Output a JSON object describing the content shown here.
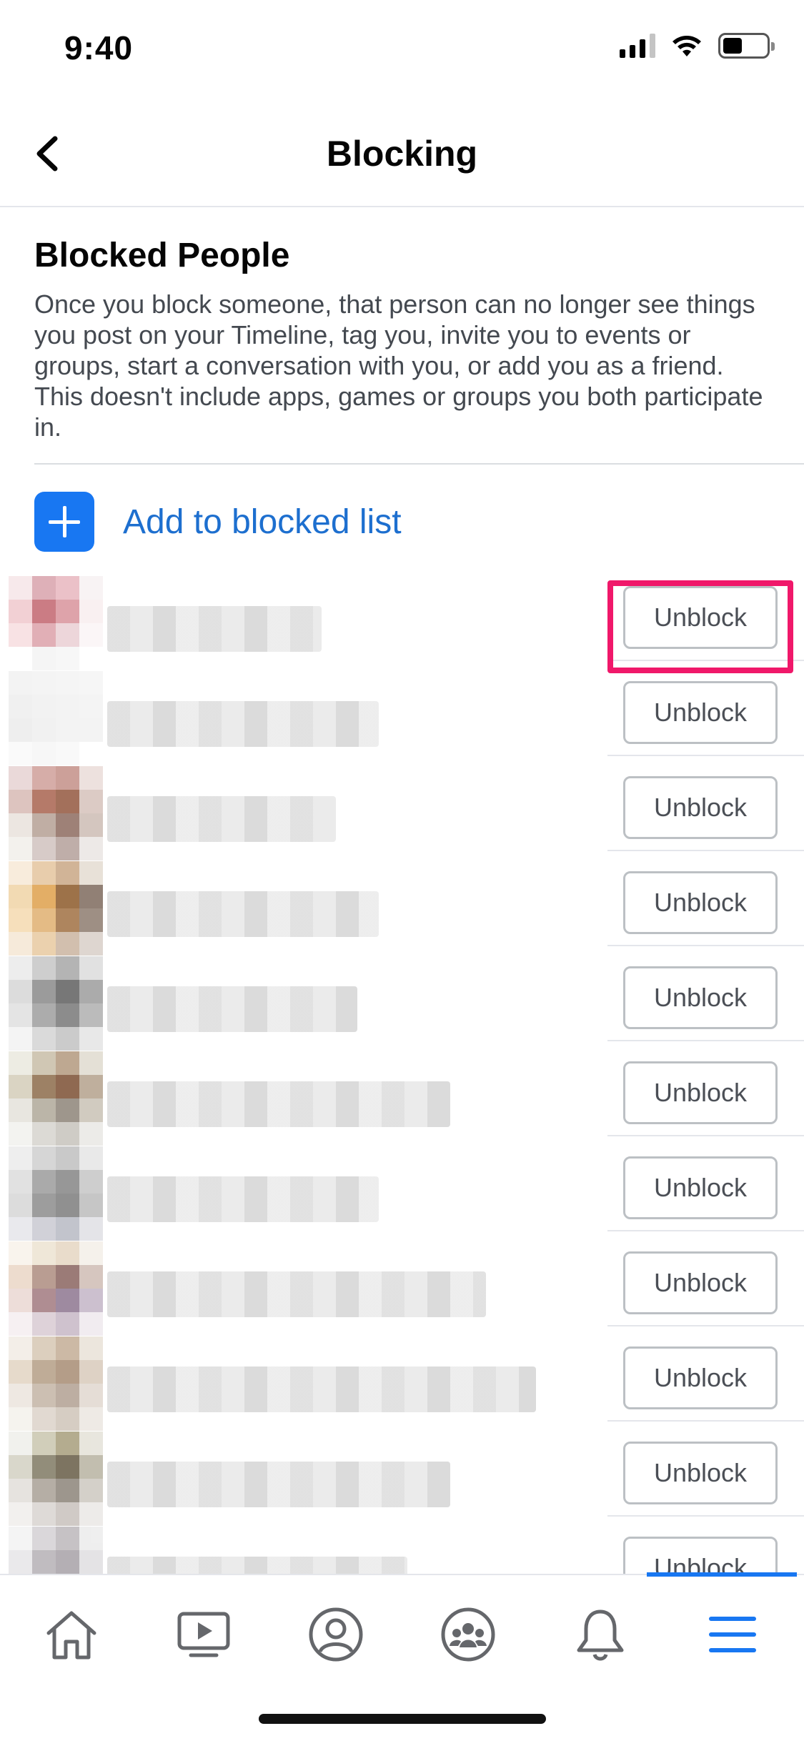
{
  "status_bar": {
    "time": "9:40"
  },
  "header": {
    "title": "Blocking"
  },
  "blocked_section": {
    "title": "Blocked People",
    "description": "Once you block someone, that person can no longer see things you post on your Timeline, tag you, invite you to events or groups, start a conversation with you, or add you as a friend. This doesn't include apps, games or groups you both participate in."
  },
  "add_action": {
    "label": "Add to blocked list"
  },
  "blocked_list": [
    {
      "unblock_label": "Unblock",
      "avatar": [
        "#f6e6e8",
        "#d9a3ac",
        "#e8b7bf",
        "#f7f2f3",
        "#f0c8cd",
        "#c3666f",
        "#d9949c",
        "#f9eeef",
        "#f7dde0",
        "#dca2aa",
        "#ead0d4",
        "#fbf5f6",
        "#ffffff",
        "#f4f4f4",
        "#f6f6f6",
        "#ffffff"
      ]
    },
    {
      "unblock_label": "Unblock",
      "avatar": [
        "#f1f1f1",
        "#f3f3f3",
        "#f4f4f4",
        "#f5f5f5",
        "#eeeeee",
        "#f0f0f0",
        "#f2f2f2",
        "#f3f3f3",
        "#ececec",
        "#efefef",
        "#f1f1f1",
        "#f2f2f2",
        "#fafafa",
        "#f6f6f6",
        "#f8f8f8",
        "#ffffff"
      ]
    },
    {
      "unblock_label": "Unblock",
      "avatar": [
        "#e7d3d3",
        "#cf9f9a",
        "#c49088",
        "#eadcd9",
        "#d8bab5",
        "#a9634f",
        "#94583f",
        "#d7c2bc",
        "#e9e2dc",
        "#b6a195",
        "#8e6c60",
        "#cdbdb5",
        "#f2efeb",
        "#d1c3bf",
        "#b4a19b",
        "#ebe6e3"
      ]
    },
    {
      "unblock_label": "Unblock",
      "avatar": [
        "#f7e9d6",
        "#e4c59e",
        "#c9a885",
        "#e5dcd2",
        "#f0d4a6",
        "#dfa04c",
        "#8d5a2a",
        "#7e6b5d",
        "#f5dab0",
        "#e0b070",
        "#a07043",
        "#8e7c6f",
        "#f5e7d4",
        "#e8c9a1",
        "#cbb5a0",
        "#d9d0c8"
      ]
    },
    {
      "unblock_label": "Unblock",
      "avatar": [
        "#ebebeb",
        "#c6c6c6",
        "#a7a7a7",
        "#dcdcdc",
        "#d7d7d7",
        "#8a8a8a",
        "#606060",
        "#9d9d9d",
        "#e0e0e0",
        "#9e9e9e",
        "#787878",
        "#b0b0b0",
        "#f3f3f3",
        "#d4d4d4",
        "#c3c3c3",
        "#e5e5e5"
      ]
    },
    {
      "unblock_label": "Unblock",
      "avatar": [
        "#ebe9df",
        "#c8bea7",
        "#b39a7e",
        "#e0dbd0",
        "#d4cdb9",
        "#8d6c4b",
        "#7c4f33",
        "#b5a28c",
        "#e4e2db",
        "#b0a99a",
        "#8e8478",
        "#c9c2b6",
        "#f2f2ee",
        "#d6d4ce",
        "#c7c4bd",
        "#e9e8e4"
      ]
    },
    {
      "unblock_label": "Unblock",
      "avatar": [
        "#ececec",
        "#cfcfcf",
        "#c0c0c0",
        "#e6e6e6",
        "#dcdcdc",
        "#9c9c9c",
        "#868686",
        "#c6c6c6",
        "#d7d7d7",
        "#8d8d8d",
        "#7d7d7d",
        "#bdbdbd",
        "#e6e6ea",
        "#c9cad2",
        "#b8bac4",
        "#e0e0e4"
      ]
    },
    {
      "unblock_label": "Unblock",
      "avatar": [
        "#f8f3ea",
        "#ede3d2",
        "#e6d7c2",
        "#f4efe8",
        "#ead6c6",
        "#ad8c7f",
        "#8a6460",
        "#cfbdb5",
        "#ead8d3",
        "#a27a80",
        "#8e7690",
        "#c4b6c7",
        "#f5eef0",
        "#d9cbd3",
        "#c7b8c6",
        "#efe9ee"
      ]
    },
    {
      "unblock_label": "Unblock",
      "avatar": [
        "#f1ece5",
        "#d6c7b3",
        "#c4ad96",
        "#e9e2d8",
        "#e2d4c3",
        "#b59e86",
        "#a88c74",
        "#d9cbbb",
        "#ece5de",
        "#c4b4a5",
        "#b2a192",
        "#e1d8cf",
        "#f4f1ec",
        "#dcd3c9",
        "#d0c5b9",
        "#ece7e1"
      ]
    },
    {
      "unblock_label": "Unblock",
      "avatar": [
        "#efefea",
        "#c9c6ae",
        "#a79e7c",
        "#e4e2d8",
        "#d3d1c3",
        "#7f7a63",
        "#675c46",
        "#b8b3a2",
        "#e2dfda",
        "#a9a196",
        "#8d847a",
        "#cdc8c0",
        "#f0eeec",
        "#d9d4d1",
        "#c8c1bd",
        "#ebe8e6"
      ]
    },
    {
      "unblock_label": "Unblock",
      "avatar": [
        "#f3f3f3",
        "#d4d1d4",
        "#bdb8bc",
        "#ececec",
        "#e7e6e8",
        "#b6b1b6",
        "#a8a2a8",
        "#e0dfe1",
        "#f1f1f1",
        "#d8d6d8",
        "#c9c6c9",
        "#eeeeee",
        "#ffffff",
        "#f7f7f7",
        "#f4f4f4",
        "#ffffff"
      ]
    }
  ],
  "tab_bar": {
    "tabs": [
      {
        "icon": "home-icon"
      },
      {
        "icon": "watch-video-icon"
      },
      {
        "icon": "profile-icon"
      },
      {
        "icon": "groups-icon"
      },
      {
        "icon": "notifications-bell-icon"
      },
      {
        "icon": "menu-icon",
        "active": true
      }
    ]
  },
  "colors": {
    "accent": "#1877f2",
    "highlight": "#f0186a"
  }
}
